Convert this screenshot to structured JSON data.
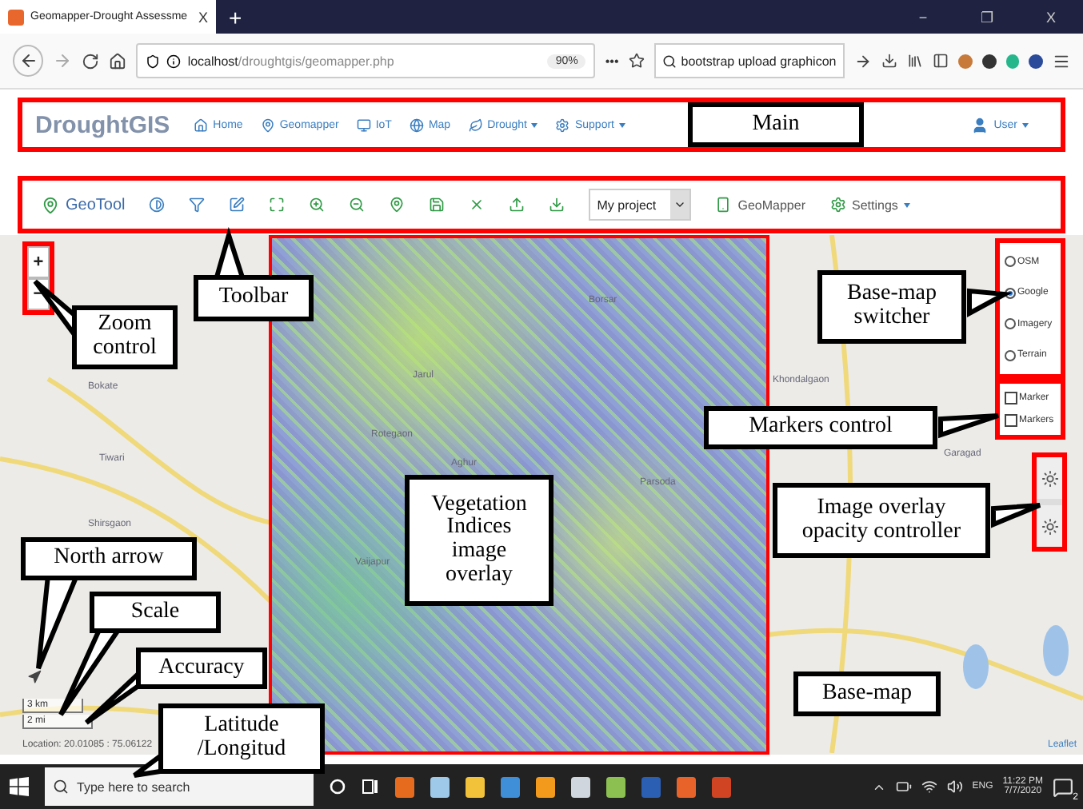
{
  "browser": {
    "tab_title": "Geomapper-Drought Assessme",
    "tab_close": "X",
    "new_tab": "+",
    "window_controls": [
      "−",
      "❐",
      "X"
    ],
    "url_host": "localhost",
    "url_path": "/droughtgis/geomapper.php",
    "zoom": "90%",
    "more": "•••",
    "search_value": "bootstrap upload graphicon"
  },
  "navbar": {
    "brand": "DroughtGIS",
    "items": [
      {
        "label": "Home",
        "dropdown": false
      },
      {
        "label": "Geomapper",
        "dropdown": false
      },
      {
        "label": "IoT",
        "dropdown": false
      },
      {
        "label": "Map",
        "dropdown": false
      },
      {
        "label": "Drought",
        "dropdown": true
      },
      {
        "label": "Support",
        "dropdown": true
      }
    ],
    "user": {
      "label": "User",
      "dropdown": true
    }
  },
  "toolbar": {
    "title": "GeoTool",
    "project_select": "My project",
    "geomapper": "GeoMapper",
    "settings": {
      "label": "Settings",
      "dropdown": true
    }
  },
  "map": {
    "zoom_in": "+",
    "zoom_out": "−",
    "basemaps": [
      {
        "label": "OSM",
        "selected": false
      },
      {
        "label": "Google",
        "selected": true
      },
      {
        "label": "Imagery",
        "selected": false
      },
      {
        "label": "Terrain",
        "selected": false
      }
    ],
    "markers": [
      {
        "label": "Marker",
        "checked": false
      },
      {
        "label": "Markers",
        "checked": false
      }
    ],
    "scale": [
      "3 km",
      "2 mi"
    ],
    "location": "Location: 20.01085 : 75.06122",
    "attribution": "Leaflet",
    "places": [
      "Bokate",
      "Tiwari",
      "Shirsgaon",
      "Jarul",
      "Rotegaon",
      "Aghur",
      "Vaijapur",
      "Borsar",
      "Parsoda",
      "Khondalgaon",
      "Garagad"
    ]
  },
  "annotations": [
    "Main",
    "Toolbar",
    "Zoom\ncontrol",
    "Base-map\nswitcher",
    "Markers control",
    "Vegetation\nIndices\nimage\noverlay",
    "Image overlay\nopacity controller",
    "North arrow",
    "Scale",
    "Accuracy",
    "Latitude\n/Longitud",
    "Base-map"
  ],
  "taskbar": {
    "search_placeholder": "Type here to search",
    "language": "ENG",
    "time": "11:22 PM",
    "date": "7/7/2020",
    "notifications": "2"
  }
}
